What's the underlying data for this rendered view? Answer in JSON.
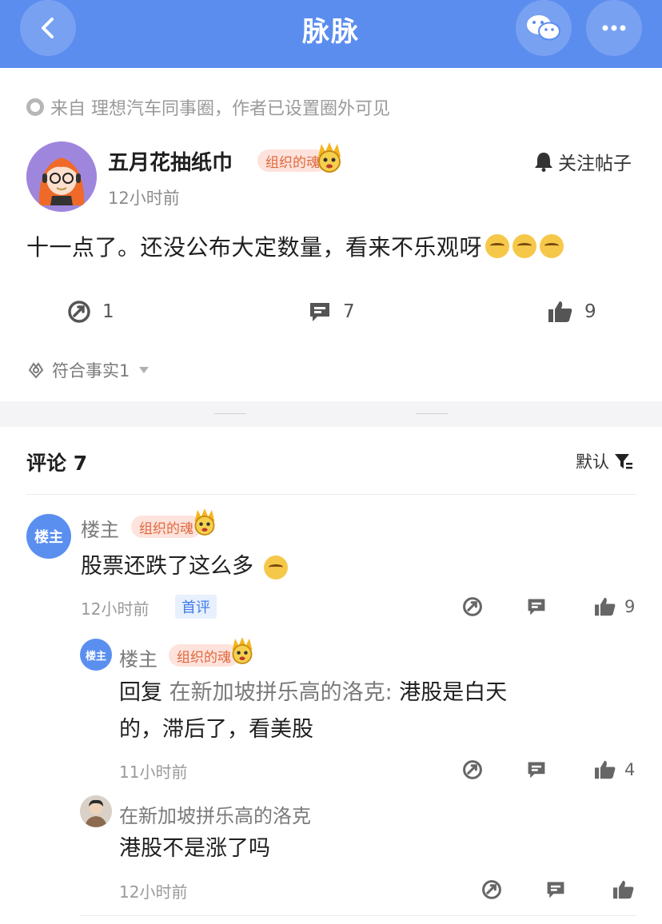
{
  "nav": {
    "title": "脉脉"
  },
  "post": {
    "source": "来自 理想汽车同事圈，作者已设置圈外可见",
    "author": "五月花抽纸巾",
    "badge": "组织的魂",
    "follow_label": "关注帖子",
    "time": "12小时前",
    "text": "十一点了。还没公布大定数量，看来不乐观呀",
    "stats": {
      "share": "1",
      "comments": "7",
      "likes": "9"
    },
    "fact_label": "符合事实1"
  },
  "comments_header": {
    "title": "评论 7",
    "sort_label": "默认"
  },
  "comments": [
    {
      "avatar_text": "楼主",
      "name": "楼主",
      "badge": "组织的魂",
      "text": "股票还跌了这么多",
      "time": "12小时前",
      "tag": "首评",
      "likes": "9"
    },
    {
      "avatar_text": "楼主",
      "name": "楼主",
      "badge": "组织的魂",
      "reply_prefix": "回复",
      "reply_to": "在新加坡拼乐高的洛克:",
      "text_line1": "港股是白天",
      "text_line2": "的，滞后了，看美股",
      "time": "11小时前",
      "likes": "4"
    },
    {
      "name": "在新加坡拼乐高的洛克",
      "text": "港股不是涨了吗",
      "time": "12小时前"
    }
  ],
  "colors": {
    "nav_bg": "#5b8def",
    "accent": "#3f7be8",
    "badge_bg": "#fde3dc",
    "badge_fg": "#e0683e"
  }
}
